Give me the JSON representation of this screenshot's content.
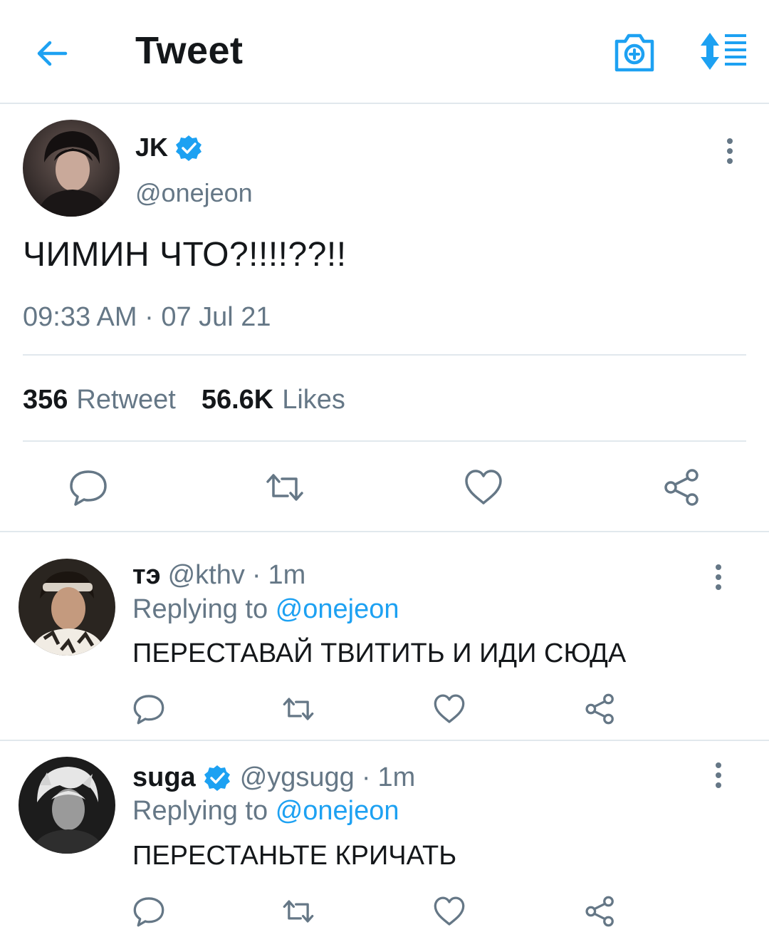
{
  "header": {
    "title": "Tweet",
    "icons": [
      "back-arrow-icon",
      "camera-plus-icon",
      "sort-lines-icon"
    ],
    "accent_color": "#1da1f2"
  },
  "main_tweet": {
    "name": "JK",
    "handle": "@onejeon",
    "verified": true,
    "text": "ЧИМИН ЧТО?!!!!??!!",
    "timestamp": "09:33 AM · 07 Jul 21",
    "retweets_count": "356",
    "retweets_label": "Retweet",
    "likes_count": "56.6K",
    "likes_label": "Likes",
    "actions": [
      "reply-icon",
      "retweet-icon",
      "like-icon",
      "share-icon"
    ]
  },
  "replies": [
    {
      "name": "тэ",
      "handle": "@kthv",
      "separator": "·",
      "time": "1m",
      "verified": false,
      "replying_prefix": "Replying to",
      "replying_to": "@onejeon",
      "text": "ПЕРЕСТАВАЙ ТВИТИТЬ И ИДИ СЮДА"
    },
    {
      "name": "suga",
      "handle": "@ygsugg",
      "separator": "·",
      "time": "1m",
      "verified": true,
      "replying_prefix": "Replying to",
      "replying_to": "@onejeon",
      "text": "ПЕРЕСТАНЬТЕ КРИЧАТЬ"
    }
  ],
  "colors": {
    "text_primary": "#14171a",
    "text_secondary": "#657786",
    "link": "#1da1f2",
    "divider": "#e1e8ed",
    "icon_gray": "#657786"
  }
}
